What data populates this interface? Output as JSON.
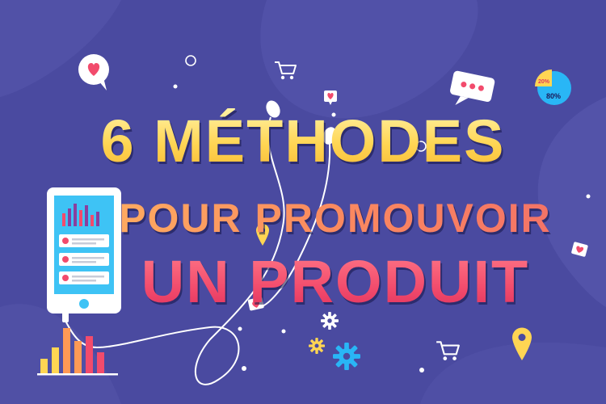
{
  "title": {
    "line1": "6 MÉTHODES",
    "line2": "POUR PROMOUVOIR",
    "line3": "UN PRODUIT"
  },
  "pie_chart": {
    "small_label": "20%",
    "large_label": "80%"
  },
  "colors": {
    "background": "#4a4aa0",
    "accent_yellow": "#ffd553",
    "accent_orange": "#fa8a5f",
    "accent_red": "#f24b6c",
    "accent_blue": "#29b6f6"
  },
  "icons": [
    "heart-bubble-icon",
    "shopping-cart-icon",
    "chat-bubble-icon",
    "pie-chart-icon",
    "smartphone-icon",
    "earphones-icon",
    "location-pin-icon",
    "gear-icon",
    "heart-tag-icon",
    "bar-chart-icon"
  ]
}
